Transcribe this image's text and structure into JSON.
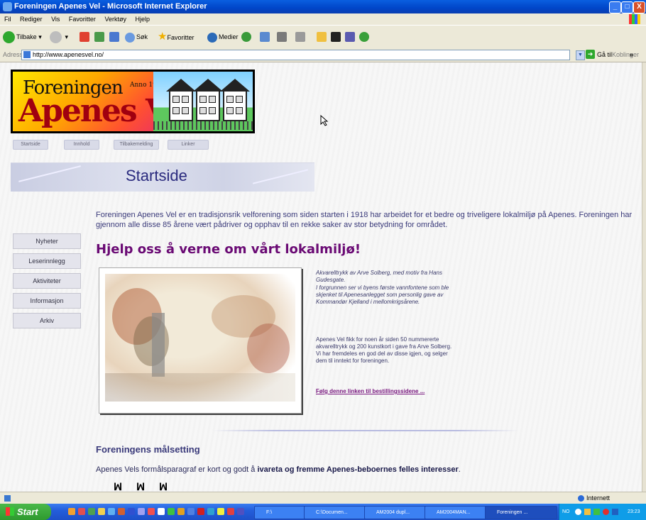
{
  "window": {
    "title": "Foreningen Apenes Vel - Microsoft Internet Explorer",
    "controls": [
      "_",
      "□",
      "X"
    ]
  },
  "menu": [
    "Fil",
    "Rediger",
    "Vis",
    "Favoritter",
    "Verktøy",
    "Hjelp"
  ],
  "toolbar": {
    "back": "Tilbake",
    "search": "Søk",
    "favorites": "Favoritter",
    "media": "Medier"
  },
  "address": {
    "label": "Adresse",
    "url": "http://www.apenesvel.no/",
    "go": "Gå til",
    "links": "Koblinger",
    "more": "»"
  },
  "site": {
    "logo_line1": "Foreningen",
    "logo_line2": "Apenes Vel",
    "logo_year": "Anno 1918",
    "nav": [
      "Startside",
      "Innhold",
      "Tilbakemelding",
      "Linker"
    ],
    "banner_title": "Startside",
    "side_menu": [
      "Nyheter",
      "Leserinnlegg",
      "Aktiviteter",
      "Informasjon",
      "Arkiv"
    ],
    "intro": "Foreningen Apenes Vel er en tradisjonsrik velforening som siden starten i 1918 har arbeidet for et bedre og triveligere lokalmiljø på Apenes. Foreningen har gjennom alle disse 85 årene vært pådriver og opphav til en rekke saker av stor betydning for området.",
    "headline": "Hjelp oss å verne om vårt lokalmiljø!",
    "caption_1": "Akvarelltrykk av Arve Solberg, med motiv fra Hans Gudesgate.",
    "caption_2": "I forgrunnen ser vi byens første vannfontene som ble skjenket til Apenesanlegget som personlig gave av Kommandør Kjelland i mellomkrigsårene.",
    "note": "Apenes Vel fikk for noen år siden 50 nummererte akvarelltrykk og 200 kunstkort i gave fra Arve Solberg. Vi har fremdeles en god del av disse igjen, og selger dem til inntekt for foreningen.",
    "order_link": "Følg denne linken til bestillingssidene ...",
    "goal_heading": "Foreningens målsetting",
    "goal_text_plain": "Apenes Vels formålsparagraf er kort og godt å ",
    "goal_text_bold": "ivareta og fremme Apenes-beboernes felles interesser",
    "goal_text_end": ".",
    "marks": "ꟽ ꟽ ꟽ"
  },
  "status": {
    "zone": "Internett"
  },
  "taskbar": {
    "start": "Start",
    "tasks": [
      "F:\\",
      "C:\\Documen...",
      "AM2004 dupl...",
      "AM2004MAN...",
      "Foreningen ..."
    ],
    "tray_lang": "NO",
    "clock": "23:23"
  },
  "colors": {
    "headline": "#6a0a74",
    "text": "#3a3a7a",
    "titlebar": "#0045c8",
    "chrome": "#ece9d8"
  }
}
